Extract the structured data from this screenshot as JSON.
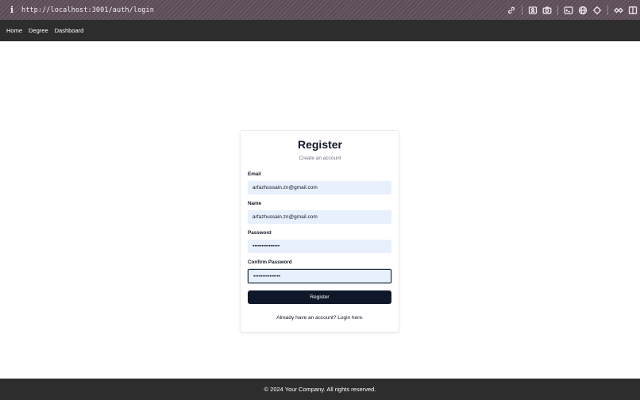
{
  "browser": {
    "url": "http://localhost:3001/auth/login",
    "info_icon": "i",
    "tools": [
      "link-icon",
      "contact-card-icon",
      "camera-icon",
      "terminal-icon",
      "globe-icon",
      "crosshair-icon",
      "extensions-icon",
      "split-view-icon"
    ]
  },
  "nav": {
    "home": "Home",
    "degree": "Degree",
    "dashboard": "Dashboard"
  },
  "form": {
    "title": "Register",
    "subtitle": "Create an account",
    "email_label": "Email",
    "email_value": "arfazhussain.zn@gmail.com",
    "name_label": "Name",
    "name_value": "arfazhussain.zn@gmail.com",
    "password_label": "Password",
    "password_value": "•••••••••••••••",
    "confirm_label": "Confirm Password",
    "confirm_value": "•••••••••••••••",
    "submit_label": "Register",
    "login_text": "Already have an account? Login here."
  },
  "footer": {
    "text": "© 2024 Your Company. All rights reserved."
  }
}
